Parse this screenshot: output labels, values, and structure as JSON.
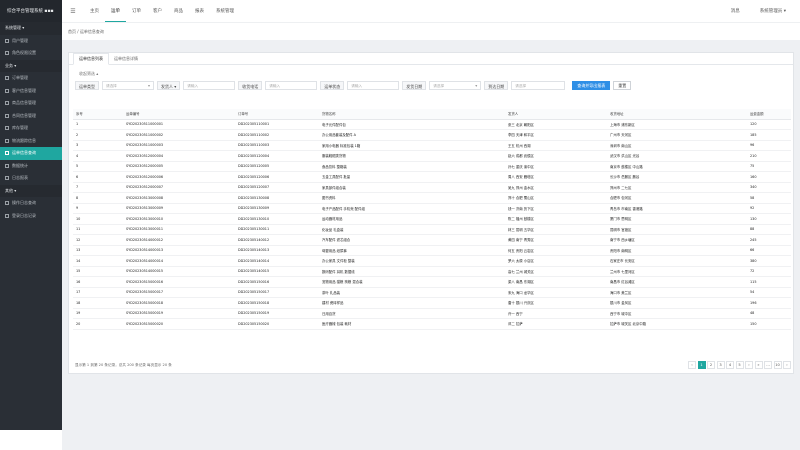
{
  "brand": {
    "title": "综合平台管理系统 ▪▪▪"
  },
  "sidebar": {
    "items": [
      {
        "label": "系统管理 ▾",
        "type": "group"
      },
      {
        "label": "用户管理",
        "type": "item"
      },
      {
        "label": "角色权限设置",
        "type": "item"
      },
      {
        "label": "业务 ▾",
        "type": "group"
      },
      {
        "label": "订单管理",
        "type": "item"
      },
      {
        "label": "客户信息管理",
        "type": "item"
      },
      {
        "label": "商品信息管理",
        "type": "item"
      },
      {
        "label": "合同信息管理",
        "type": "item"
      },
      {
        "label": "库存管理",
        "type": "item"
      },
      {
        "label": "物流跟踪信息",
        "type": "item"
      },
      {
        "label": "运单信息查询",
        "type": "item",
        "active": true
      },
      {
        "label": "数据统计",
        "type": "item"
      },
      {
        "label": "日志报表",
        "type": "item"
      },
      {
        "label": "其他 ▾",
        "type": "group"
      },
      {
        "label": "操作日志查询",
        "type": "item"
      },
      {
        "label": "登录日志记录",
        "type": "item"
      }
    ]
  },
  "topnav": {
    "menu_icon": "menu-icon",
    "items": [
      "主页",
      "运单",
      "订单",
      "客户",
      "商品",
      "报表",
      "系统管理"
    ],
    "right_items": [
      "消息",
      "系统管理员 ▾"
    ]
  },
  "breadcrumb": "首页 / 运单信息查询",
  "tabs": [
    "运单信息列表",
    "运单信息详情"
  ],
  "fold_text": "收起筛选 ▴",
  "filters": [
    {
      "label": "运单类型",
      "placeholder": "请选择",
      "size": "",
      "caret": "▾"
    },
    {
      "label": "发货人 ▾",
      "placeholder": "请输入",
      "size": "",
      "caret": ""
    },
    {
      "label": "收货电话",
      "placeholder": "请输入",
      "size": "",
      "caret": ""
    },
    {
      "label": "运单状态",
      "placeholder": "请输入",
      "size": "",
      "caret": ""
    },
    {
      "label": "发货日期",
      "placeholder": "请选择",
      "size": "",
      "caret": "▾"
    },
    {
      "label": "到达日期",
      "placeholder": "请选择",
      "size": "md",
      "caret": ""
    }
  ],
  "buttons": {
    "search": "查询并导出报表",
    "reset": "重置"
  },
  "table": {
    "headers": [
      "序号",
      "运单编号",
      "订单号",
      "货物名称",
      "发货人",
      "收货地址",
      "运费金额"
    ],
    "rows": [
      [
        "1",
        "SYD20230511000001",
        "DD202305110001",
        "电子元件配件包",
        "张三 北京 朝阳区",
        "上海市 浦东新区",
        "120"
      ],
      [
        "2",
        "SYD20230511000002",
        "DD202305110002",
        "办公用品套装及配件 A",
        "李四 天津 和平区",
        "广州市 天河区",
        "185"
      ],
      [
        "3",
        "SYD20230511000003",
        "DD202305110003",
        "家用小电器 标准包装 1箱",
        "王五 杭州 西湖",
        "深圳市 南山区",
        "96"
      ],
      [
        "4",
        "SYD20230512000004",
        "DD202305120004",
        "服装鞋帽类货物",
        "赵六 成都 武侯区",
        "武汉市 洪山区 光谷",
        "210"
      ],
      [
        "5",
        "SYD20230512000005",
        "DD202305120005",
        "食品饮料 整箱装",
        "孙七 重庆 渝中区",
        "南京市 鼓楼区 中山路",
        "75"
      ],
      [
        "6",
        "SYD20230512000006",
        "DD202305120006",
        "五金工具配件 批量",
        "周八 西安 雁塔区",
        "长沙市 岳麓区 麓谷",
        "160"
      ],
      [
        "7",
        "SYD20230512000007",
        "DD202305120007",
        "家具部件组合装",
        "吴九 郑州 金水区",
        "郑州市 二七区",
        "340"
      ],
      [
        "8",
        "SYD20230513000008",
        "DD202305130008",
        "图书资料",
        "郑十 合肥 蜀山区",
        "合肥市 包河区",
        "58"
      ],
      [
        "9",
        "SYD20230513000009",
        "DD202305130009",
        "电子产品配件 手机壳 配件组",
        "钱一 济南 历下区",
        "青岛市 市南区 香港路",
        "92"
      ],
      [
        "10",
        "SYD20230513000010",
        "DD202305130010",
        "运动器材用品",
        "陈二 福州 鼓楼区",
        "厦门市 思明区",
        "130"
      ],
      [
        "11",
        "SYD20230513000011",
        "DD202305130011",
        "化妆品 礼盒装",
        "林三 昆明 五华区",
        "昆明市 官渡区",
        "88"
      ],
      [
        "12",
        "SYD20230514000012",
        "DD202305140012",
        "汽车配件 滤芯组合",
        "黄四 南宁 青秀区",
        "南宁市 西乡塘区",
        "245"
      ],
      [
        "13",
        "SYD20230514000013",
        "DD202305140013",
        "母婴用品 纸尿裤",
        "何五 贵阳 云岩区",
        "贵阳市 南明区",
        "66"
      ],
      [
        "14",
        "SYD20230514000014",
        "DD202305140014",
        "办公家具 文件柜 整装",
        "罗六 太原 小店区",
        "石家庄市 长安区",
        "380"
      ],
      [
        "15",
        "SYD20230514000015",
        "DD202305140015",
        "数码配件 耳机 数据线",
        "高七 兰州 城关区",
        "兰州市 七里河区",
        "72"
      ],
      [
        "16",
        "SYD20230515000016",
        "DD202305150016",
        "宠物用品 猫粮 狗粮 混合装",
        "梁八 南昌 东湖区",
        "南昌市 红谷滩区",
        "115"
      ],
      [
        "17",
        "SYD20230515000017",
        "DD202305150017",
        "茶叶 礼品装",
        "宋九 海口 龙华区",
        "海口市 美兰区",
        "54"
      ],
      [
        "18",
        "SYD20230515000018",
        "DD202305150018",
        "建材 瓷砖样品",
        "唐十 银川 兴庆区",
        "银川市 金凤区",
        "196"
      ],
      [
        "19",
        "SYD20230515000019",
        "DD202305150019",
        "日用百货",
        "许一 西宁",
        "西宁市 城中区",
        "48"
      ],
      [
        "20",
        "SYD20230515000020",
        "DD202305150020",
        "医疗器械 包装 耗材",
        "邓二 拉萨",
        "拉萨市 城关区 北京中路",
        "150"
      ]
    ]
  },
  "pager": {
    "info": "显示第 1 到第 20 条记录，总共 200 条记录 每页显示 20 条",
    "pages": [
      "‹",
      "1",
      "2",
      "3",
      "4",
      "5",
      "›",
      "»",
      "…",
      "10",
      "›"
    ]
  }
}
